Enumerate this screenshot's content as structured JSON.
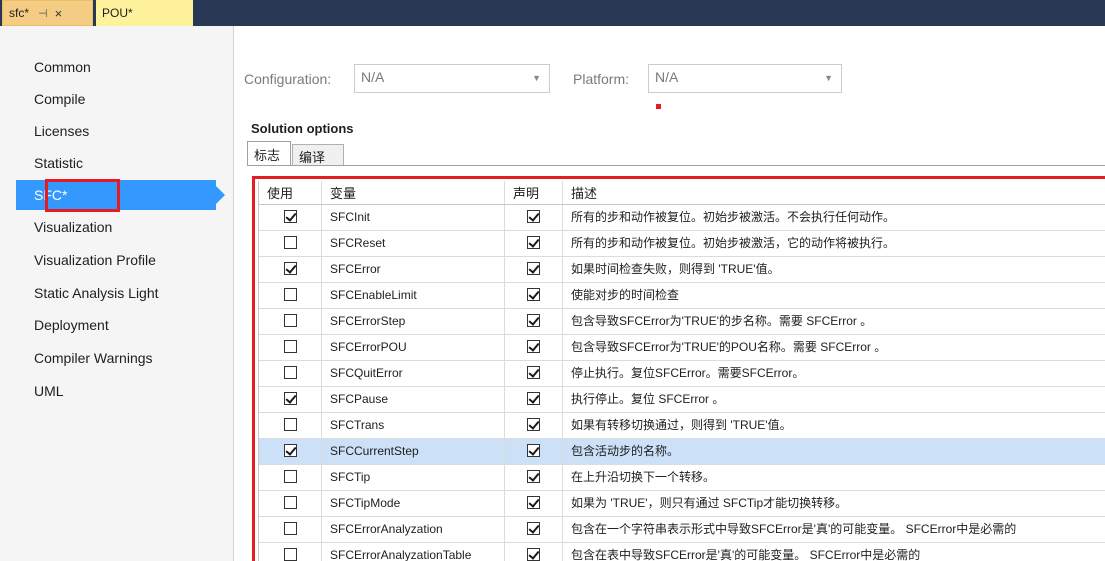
{
  "tabs": [
    {
      "label": "sfc*",
      "pin": "⊣",
      "close": "×"
    },
    {
      "label": "POU*"
    }
  ],
  "nav": {
    "items": [
      {
        "label": "Common"
      },
      {
        "label": "Compile"
      },
      {
        "label": "Licenses"
      },
      {
        "label": "Statistic"
      },
      {
        "label": "SFC*"
      },
      {
        "label": "Visualization"
      },
      {
        "label": "Visualization Profile"
      },
      {
        "label": "Static Analysis Light"
      },
      {
        "label": "Deployment"
      },
      {
        "label": "Compiler Warnings"
      },
      {
        "label": "UML"
      }
    ],
    "selected": "SFC*"
  },
  "config": {
    "configuration_label": "Configuration:",
    "configuration_value": "N/A",
    "platform_label": "Platform:",
    "platform_value": "N/A"
  },
  "solution": {
    "title": "Solution options",
    "tabs": [
      "标志",
      "编译"
    ]
  },
  "grid": {
    "headers": {
      "use": "使用",
      "var": "变量",
      "decl": "声明",
      "desc": "描述"
    },
    "rows": [
      {
        "use": true,
        "var": "SFCInit",
        "decl": true,
        "desc": "所有的步和动作被复位。初始步被激活。不会执行任何动作。"
      },
      {
        "use": false,
        "var": "SFCReset",
        "decl": true,
        "desc": "所有的步和动作被复位。初始步被激活，它的动作将被执行。"
      },
      {
        "use": true,
        "var": "SFCError",
        "decl": true,
        "desc": "如果时间检查失败，则得到 'TRUE'值。"
      },
      {
        "use": false,
        "var": "SFCEnableLimit",
        "decl": true,
        "desc": "使能对步的时间检查"
      },
      {
        "use": false,
        "var": "SFCErrorStep",
        "decl": true,
        "desc": "包含导致SFCError为'TRUE'的步名称。需要 SFCError 。"
      },
      {
        "use": false,
        "var": "SFCErrorPOU",
        "decl": true,
        "desc": "包含导致SFCError为'TRUE'的POU名称。需要 SFCError 。"
      },
      {
        "use": false,
        "var": "SFCQuitError",
        "decl": true,
        "desc": "停止执行。复位SFCError。需要SFCError。"
      },
      {
        "use": true,
        "var": "SFCPause",
        "decl": true,
        "desc": "执行停止。复位 SFCError 。"
      },
      {
        "use": false,
        "var": "SFCTrans",
        "decl": true,
        "desc": "如果有转移切换通过，则得到 'TRUE'值。"
      },
      {
        "use": true,
        "var": "SFCCurrentStep",
        "decl": true,
        "desc": "包含活动步的名称。"
      },
      {
        "use": false,
        "var": "SFCTip",
        "decl": true,
        "desc": "在上升沿切换下一个转移。"
      },
      {
        "use": false,
        "var": "SFCTipMode",
        "decl": true,
        "desc": "如果为 'TRUE'，则只有通过 SFCTip才能切换转移。"
      },
      {
        "use": false,
        "var": "SFCErrorAnalyzation",
        "decl": true,
        "desc": "包含在一个字符串表示形式中导致SFCError是'真'的可能变量。 SFCError中是必需的"
      },
      {
        "use": false,
        "var": "SFCErrorAnalyzationTable",
        "decl": true,
        "desc": "包含在表中导致SFCError是'真'的可能变量。 SFCError中是必需的"
      }
    ],
    "highlighted_row": "SFCCurrentStep"
  },
  "colors": {
    "tabstrip": "#293955",
    "active_tab": "#f5cc84",
    "selection": "#3399ff",
    "annotation_red": "#e51c23",
    "row_highlight": "#cce0f7"
  }
}
